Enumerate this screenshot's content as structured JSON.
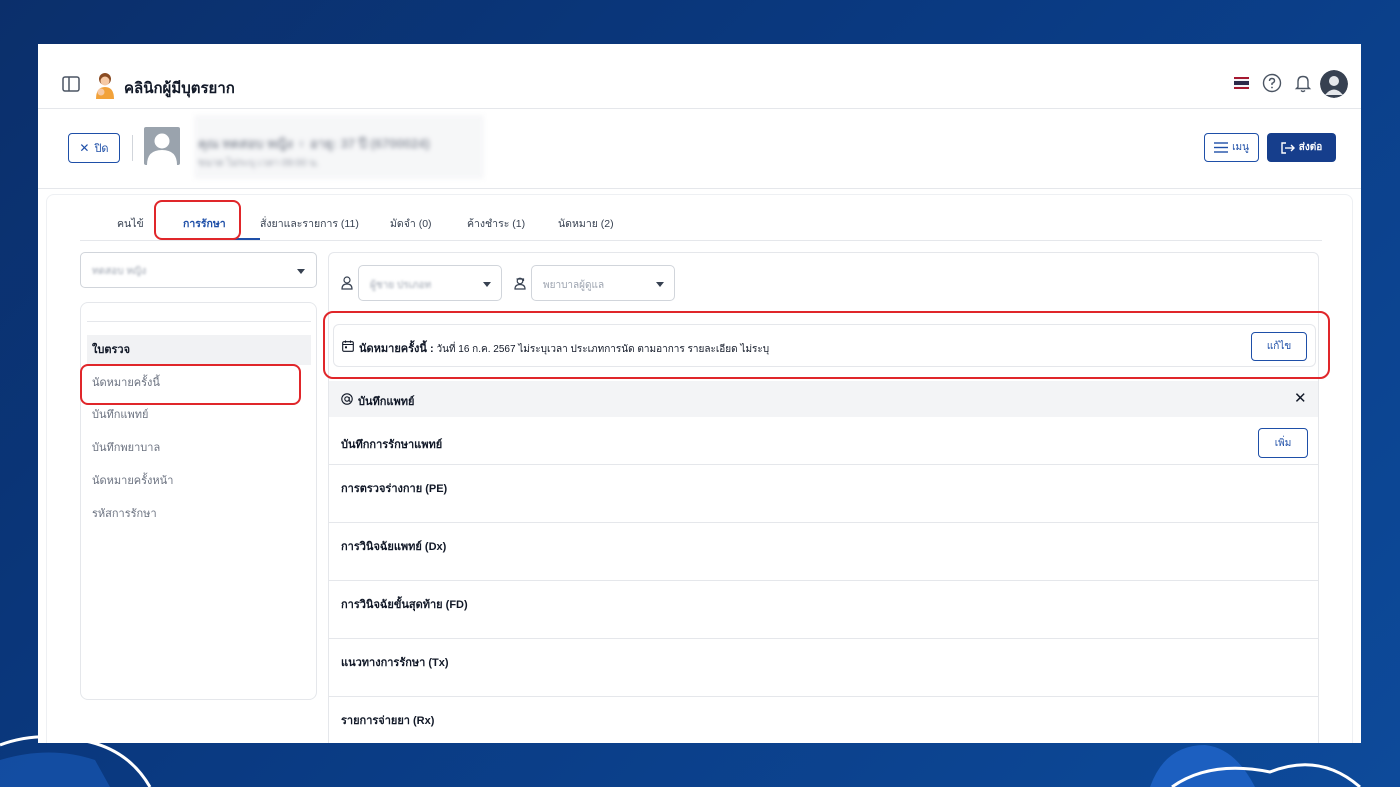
{
  "app": {
    "title": "คลินิกผู้มีบุตรยาก"
  },
  "patient": {
    "close_label": "ปิด",
    "name": "คุณ ทดสอบ หญิง ♀ อายุ: 37 ปี (6700024)",
    "meta": "ขนาด    ไม่ระบุ    เวลา 09:00 น.",
    "menu_label": "เมนู",
    "send_label": "ส่งต่อ"
  },
  "tabs": [
    {
      "label": "คนไข้"
    },
    {
      "label": "การรักษา"
    },
    {
      "label": "สั่งยาและรายการ (11)"
    },
    {
      "label": "มัดจำ (0)"
    },
    {
      "label": "ค้างชำระ (1)"
    },
    {
      "label": "นัดหมาย (2)"
    }
  ],
  "left": {
    "select_placeholder": "ทดสอบ หญิง",
    "nav": [
      {
        "label": "ใบตรวจ"
      },
      {
        "label": "นัดหมายครั้งนี้"
      },
      {
        "label": "บันทึกแพทย์"
      },
      {
        "label": "บันทึกพยาบาล"
      },
      {
        "label": "นัดหมายครั้งหน้า"
      },
      {
        "label": "รหัสการรักษา"
      }
    ]
  },
  "filters": {
    "doctor_placeholder": "ผู้ชาย ปรเภอท",
    "nurse_placeholder": "พยาบาลผู้ดูแล"
  },
  "appointment": {
    "label": "นัดหมายครั้งนี้ :",
    "detail": "วันที่ 16 ก.ค. 2567 ไม่ระบุเวลา   ประเภทการนัด ตามอาการ   รายละเอียด ไม่ระบุ",
    "edit_label": "แก้ไข"
  },
  "doctor_notes": {
    "header": "บันทึกแพทย์",
    "close_symbol": "✕",
    "treatment_title": "บันทึกการรักษาแพทย์",
    "add_label": "เพิ่ม",
    "sections": [
      {
        "label": "การตรวจร่างกาย (PE)"
      },
      {
        "label": "การวินิจฉัยแพทย์ (Dx)"
      },
      {
        "label": "การวินิจฉัยขั้นสุดท้าย (FD)"
      },
      {
        "label": "แนวทางการรักษา (Tx)"
      },
      {
        "label": "รายการจ่ายยา (Rx)"
      }
    ]
  },
  "colors": {
    "primary": "#1e4fa8",
    "primary_dark": "#163e8c",
    "highlight": "#e0262a",
    "background": "#0b2f6b"
  }
}
